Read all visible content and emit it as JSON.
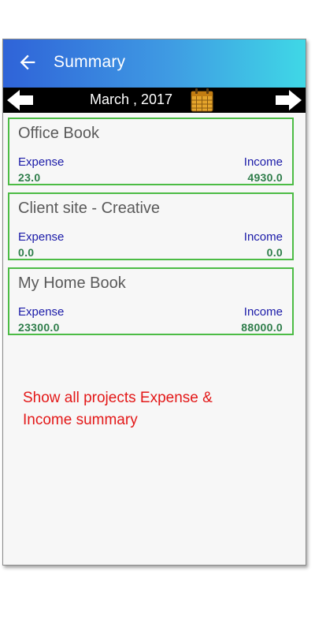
{
  "app": {
    "title": "Summary"
  },
  "date_nav": {
    "label": "March , 2017"
  },
  "labels": {
    "expense": "Expense",
    "income": "Income"
  },
  "projects": [
    {
      "name": "Office Book",
      "expense": "23.0",
      "income": "4930.0"
    },
    {
      "name": "Client site - Creative",
      "expense": "0.0",
      "income": "0.0"
    },
    {
      "name": "My Home Book",
      "expense": "23300.0",
      "income": "88000.0"
    }
  ],
  "annotation": "Show all projects Expense & Income summary",
  "icons": {
    "back": "arrow-left-icon",
    "prev": "arrow-left-icon",
    "next": "arrow-right-icon",
    "calendar": "calendar-icon"
  },
  "colors": {
    "card_border": "#4cbc45",
    "label": "#1a1aa8",
    "value": "#2e7d4a",
    "annotation": "#e31818"
  }
}
